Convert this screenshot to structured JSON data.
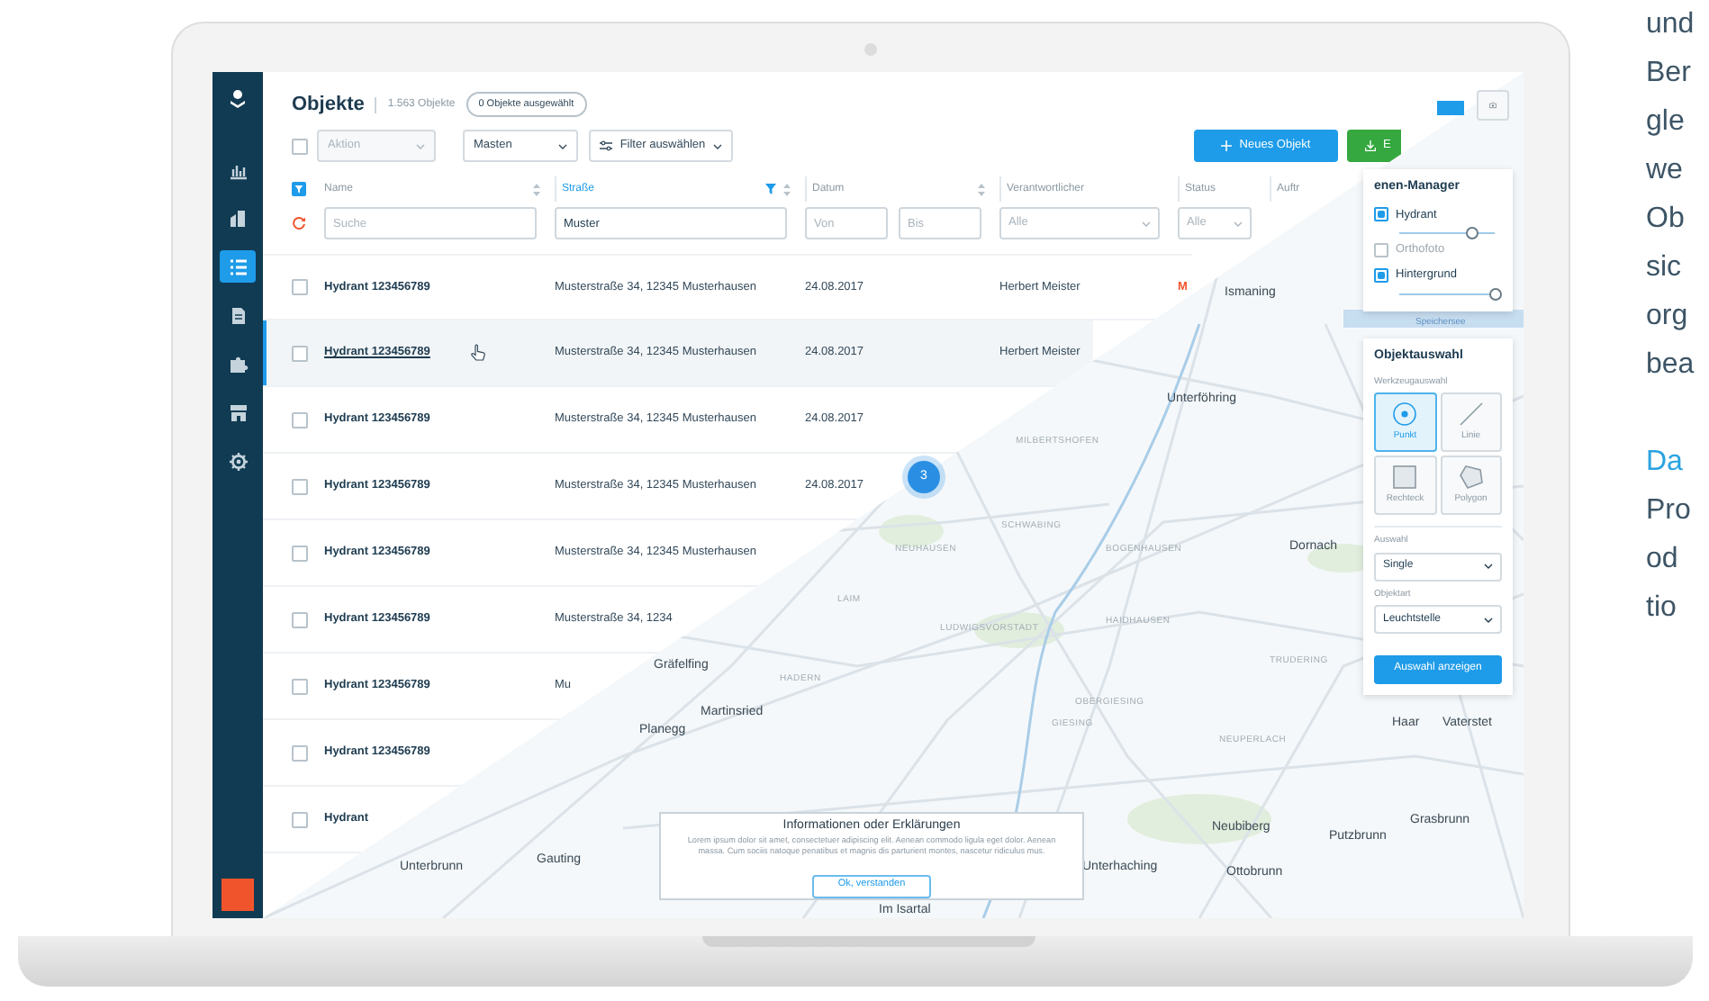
{
  "sidebar": {
    "items": [
      {
        "kind": "logo",
        "selected": false
      },
      {
        "kind": "chart",
        "selected": false
      },
      {
        "kind": "buildings",
        "selected": false
      },
      {
        "kind": "list",
        "selected": true
      },
      {
        "kind": "document",
        "selected": false
      },
      {
        "kind": "puzzle",
        "selected": false
      },
      {
        "kind": "store",
        "selected": false
      },
      {
        "kind": "gear",
        "selected": false
      }
    ]
  },
  "header": {
    "title": "Objekte",
    "count": "1.563 Objekte",
    "selection_badge": "0 Objekte ausgewählt"
  },
  "select_all": {
    "checked": false
  },
  "toolbar": {
    "action_select": {
      "placeholder": "Aktion"
    },
    "type_select": {
      "value": "Masten"
    },
    "filter_button": "Filter auswählen",
    "new_button": "Neues Objekt",
    "export_button": "E"
  },
  "columns": [
    {
      "label": "Name",
      "active": false,
      "sortable": true,
      "filter": [
        {
          "kind": "text",
          "placeholder": "Suche"
        }
      ]
    },
    {
      "label": "Straße",
      "active": true,
      "sortable": true,
      "filter": [
        {
          "kind": "text",
          "value": "Muster"
        }
      ]
    },
    {
      "label": "Datum",
      "active": false,
      "sortable": true,
      "filter": [
        {
          "kind": "text",
          "placeholder": "Von"
        },
        {
          "kind": "text",
          "placeholder": "Bis"
        }
      ]
    },
    {
      "label": "Verantwortlicher",
      "active": false,
      "sortable": false,
      "filter": [
        {
          "kind": "select",
          "placeholder": "Alle"
        }
      ]
    },
    {
      "label": "Status",
      "active": false,
      "sortable": false,
      "filter": [
        {
          "kind": "select",
          "placeholder": "Alle"
        }
      ]
    },
    {
      "label": "Auftr",
      "active": false
    }
  ],
  "rows": [
    {
      "selected": false,
      "checked": false,
      "cells": [
        "Hydrant 123456789",
        "Musterstraße 34, 12345 Musterhausen",
        "24.08.2017",
        "Herbert Meister",
        "M"
      ]
    },
    {
      "selected": true,
      "checked": false,
      "cells": [
        "Hydrant 123456789",
        "Musterstraße 34, 12345 Musterhausen",
        "24.08.2017",
        "Herbert Meister"
      ]
    },
    {
      "selected": false,
      "checked": false,
      "cells": [
        "Hydrant 123456789",
        "Musterstraße 34, 12345 Musterhausen",
        "24.08.2017"
      ]
    },
    {
      "selected": false,
      "checked": false,
      "cells": [
        "Hydrant 123456789",
        "Musterstraße 34, 12345 Musterhausen",
        "24.08.2017"
      ]
    },
    {
      "selected": false,
      "checked": false,
      "cells": [
        "Hydrant 123456789",
        "Musterstraße 34, 12345 Musterhausen"
      ]
    },
    {
      "selected": false,
      "checked": false,
      "cells": [
        "Hydrant 123456789",
        "Musterstraße 34, 1234"
      ]
    },
    {
      "selected": false,
      "checked": false,
      "cells": [
        "Hydrant 123456789",
        "Mu"
      ]
    },
    {
      "selected": false,
      "checked": false,
      "cells": [
        "Hydrant 123456789"
      ]
    },
    {
      "selected": false,
      "checked": false,
      "cells": [
        "Hydrant"
      ]
    }
  ],
  "map": {
    "cluster": "3",
    "labels": [
      {
        "text": "Ismaning",
        "kind": "town"
      },
      {
        "text": "Unterföhring",
        "kind": "town"
      },
      {
        "text": "Speichersee",
        "kind": "water"
      },
      {
        "text": "MILBERTSHOFEN",
        "kind": "district"
      },
      {
        "text": "SCHWABING",
        "kind": "district"
      },
      {
        "text": "NEUHAUSEN",
        "kind": "district"
      },
      {
        "text": "BOGENHAUSEN",
        "kind": "district"
      },
      {
        "text": "Dornach",
        "kind": "town"
      },
      {
        "text": "LAIM",
        "kind": "district"
      },
      {
        "text": "LUDWIGSVORSTADT",
        "kind": "district"
      },
      {
        "text": "HAIDHAUSEN",
        "kind": "district"
      },
      {
        "text": "TRUDERING",
        "kind": "district"
      },
      {
        "text": "HADERN",
        "kind": "district"
      },
      {
        "text": "Gräfelfing",
        "kind": "town"
      },
      {
        "text": "Martinsried",
        "kind": "town"
      },
      {
        "text": "Planegg",
        "kind": "town"
      },
      {
        "text": "OBERGIESING",
        "kind": "district"
      },
      {
        "text": "GIESING",
        "kind": "district"
      },
      {
        "text": "NEUPERLACH",
        "kind": "district"
      },
      {
        "text": "Haar",
        "kind": "town"
      },
      {
        "text": "Vaterstet",
        "kind": "town"
      },
      {
        "text": "Neubiberg",
        "kind": "town"
      },
      {
        "text": "Putzbrunn",
        "kind": "town"
      },
      {
        "text": "Grasbrunn",
        "kind": "town"
      },
      {
        "text": "Unterhaching",
        "kind": "town"
      },
      {
        "text": "Ottobrunn",
        "kind": "town"
      },
      {
        "text": "Unterbrunn",
        "kind": "town"
      },
      {
        "text": "Gauting",
        "kind": "town"
      },
      {
        "text": "Im Isartal",
        "kind": "town"
      }
    ]
  },
  "layer_manager": {
    "title": "enen-Manager",
    "layers": [
      {
        "label": "Hydrant",
        "checked": true,
        "level": 0.75
      },
      {
        "label": "Orthofoto",
        "checked": false
      },
      {
        "label": "Hintergrund",
        "checked": true,
        "level": 1
      }
    ]
  },
  "object_selection": {
    "title": "Objektauswahl",
    "tools_label": "Werkzeugauswahl",
    "tools": [
      {
        "label": "Punkt",
        "kind": "point",
        "selected": true
      },
      {
        "label": "Linie",
        "kind": "line",
        "selected": false
      },
      {
        "label": "Rechteck",
        "kind": "rect",
        "selected": false
      },
      {
        "label": "Polygon",
        "kind": "polygon",
        "selected": false
      }
    ],
    "selection_label": "Auswahl",
    "selection_value": "Single",
    "type_label": "Objektart",
    "type_value": "Leuchtstelle",
    "button": "Auswahl anzeigen"
  },
  "info_dialog": {
    "title": "Informationen oder Erklärungen",
    "text": "Lorem ipsum dolor sit amet, consectetuer adipiscing elit. Aenean commodo ligula eget dolor. Aenean massa. Cum sociis natoque penatibus et magnis dis parturient montes, nascetur ridiculus mus.",
    "button": "Ok, verstanden"
  },
  "side_text": {
    "paragraphs": [
      {
        "lines": [
          {
            "text": "und",
            "kind": "plain"
          },
          {
            "text": "Ber",
            "kind": "plain"
          },
          {
            "text": "gle",
            "kind": "plain"
          },
          {
            "text": "we",
            "kind": "plain"
          },
          {
            "text": "Ob",
            "kind": "plain"
          },
          {
            "text": "sic",
            "kind": "plain"
          },
          {
            "text": "org",
            "kind": "plain"
          },
          {
            "text": "bea",
            "kind": "plain"
          }
        ]
      },
      {
        "lines": [
          {
            "text": "Da",
            "kind": "heading"
          },
          {
            "text": "Pro",
            "kind": "plain"
          },
          {
            "text": "od",
            "kind": "plain"
          },
          {
            "text": "tio",
            "kind": "plain"
          }
        ]
      }
    ]
  }
}
